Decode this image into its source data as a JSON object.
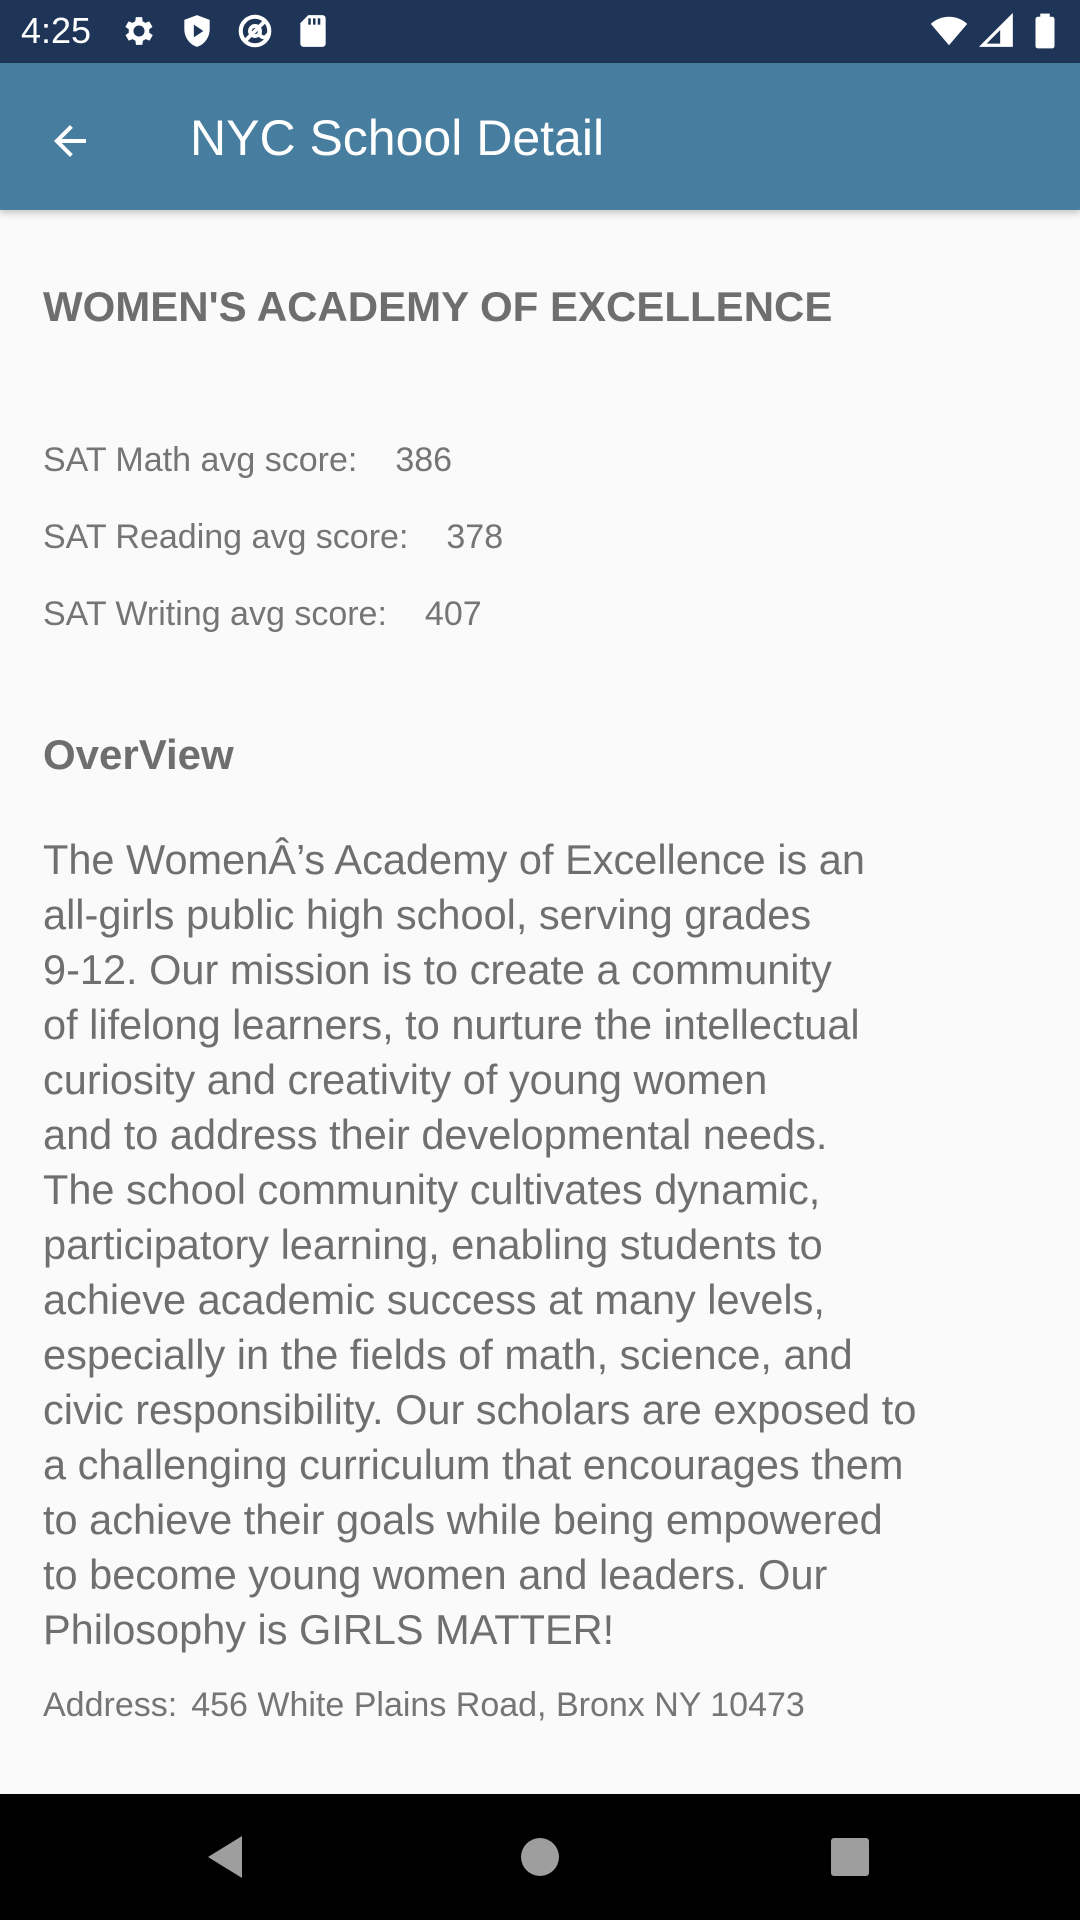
{
  "status_bar": {
    "time": "4:25",
    "left_icons": [
      "settings-gear-icon",
      "shield-play-icon",
      "at-sign-icon",
      "sd-card-icon"
    ],
    "right_icons": [
      "wifi-icon",
      "cellular-signal-icon",
      "battery-icon"
    ]
  },
  "app_bar": {
    "title": "NYC School Detail",
    "back_icon": "arrow-back-icon",
    "color": "#477e9f"
  },
  "school": {
    "name": "WOMEN'S ACADEMY OF EXCELLENCE",
    "sat_math_label": "SAT Math avg score:",
    "sat_math_value": "386",
    "sat_reading_label": "SAT Reading avg score:",
    "sat_reading_value": "378",
    "sat_writing_label": "SAT Writing avg score:",
    "sat_writing_value": "407",
    "overview_heading": "OverView",
    "overview_text": "The WomenÂ’s Academy of Excellence is an\nall-girls public high school, serving grades\n9-12. Our mission is to create a community\nof lifelong learners, to nurture the intellectual\ncuriosity and creativity of young women\nand to address their developmental needs.\nThe school community cultivates dynamic,\nparticipatory learning, enabling students to\nachieve academic success at many levels,\nespecially in the fields of math, science, and\ncivic responsibility. Our scholars are exposed to\na challenging curriculum that encourages them\nto achieve their goals while being empowered\nto become young women and leaders. Our\nPhilosophy is GIRLS MATTER!",
    "address_label": "Address:",
    "address_value": "456 White Plains Road, Bronx NY 10473"
  },
  "nav_bar": {
    "icons": [
      "nav-back-icon",
      "nav-home-icon",
      "nav-recents-icon"
    ]
  },
  "colors": {
    "status_bar": "#1f3557",
    "app_bar": "#477e9f",
    "background": "#fafafa",
    "text": "#6f6f6f"
  }
}
